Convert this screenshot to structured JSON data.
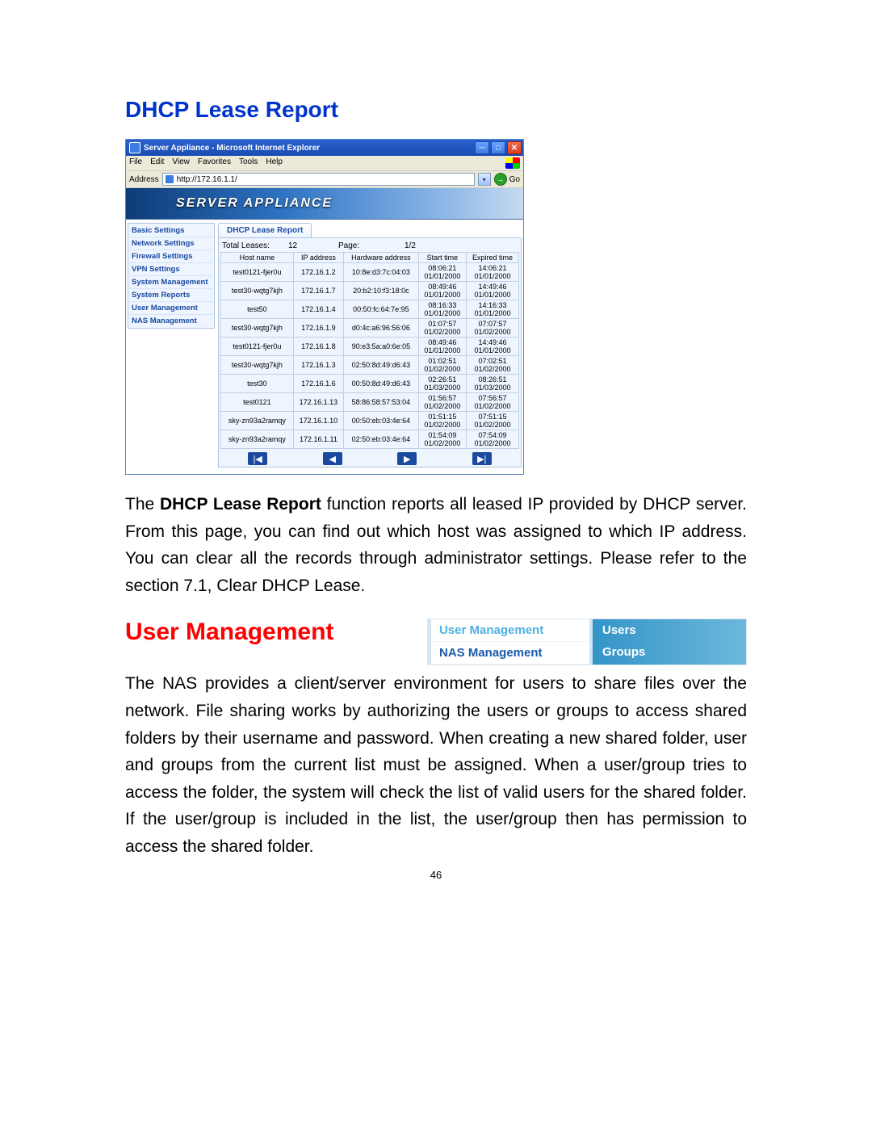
{
  "doc": {
    "heading1": "DHCP Lease Report",
    "para1_prefix": "The ",
    "para1_bold": "DHCP Lease Report",
    "para1_rest": " function reports all leased IP provided by DHCP server. From this page, you can find out which host was assigned to which IP address. You can clear all the records through administrator settings. Please refer to the section 7.1, Clear DHCP Lease.",
    "heading2": "User Management",
    "para2": "The NAS provides a client/server environment for users to share files over the network. File sharing works by authorizing the users or groups to access shared folders by their username and password. When creating a new shared folder, user and groups from the current list must be assigned. When a user/group tries to access the folder, the system will check the list of valid users for the shared folder. If the user/group is included in the list, the user/group then has permission to access the shared folder.",
    "page_number": "46"
  },
  "ie": {
    "title": "Server Appliance - Microsoft Internet Explorer",
    "menus": [
      "File",
      "Edit",
      "View",
      "Favorites",
      "Tools",
      "Help"
    ],
    "address_label": "Address",
    "url": "http://172.16.1.1/",
    "go_label": "Go",
    "banner": "SERVER APPLIANCE",
    "sidebar": [
      "Basic Settings",
      "Network Settings",
      "Firewall Settings",
      "VPN Settings",
      "System Management",
      "System Reports",
      "User Management",
      "NAS Management"
    ],
    "tab": "DHCP Lease Report",
    "summary": {
      "total_label": "Total Leases:",
      "total_value": "12",
      "page_label": "Page:",
      "page_value": "1/2"
    },
    "columns": [
      "Host name",
      "IP address",
      "Hardware address",
      "Start time",
      "Expired time"
    ],
    "rows": [
      {
        "host": "test0121-fjer0u",
        "ip": "172.16.1.2",
        "hw": "10:8e:d3:7c:04:03",
        "st": "08:06:21 01/01/2000",
        "et": "14:06:21 01/01/2000"
      },
      {
        "host": "test30-wqtg7kjh",
        "ip": "172.16.1.7",
        "hw": "20:b2:10:f3:18:0c",
        "st": "08:49:46 01/01/2000",
        "et": "14:49:46 01/01/2000"
      },
      {
        "host": "test50",
        "ip": "172.16.1.4",
        "hw": "00:50:fc:64:7e:95",
        "st": "08:16:33 01/01/2000",
        "et": "14:16:33 01/01/2000"
      },
      {
        "host": "test30-wqtg7kjh",
        "ip": "172.16.1.9",
        "hw": "d0:4c:a6:96:56:06",
        "st": "01:07:57 01/02/2000",
        "et": "07:07:57 01/02/2000"
      },
      {
        "host": "test0121-fjer0u",
        "ip": "172.16.1.8",
        "hw": "90:e3:5a:a0:6e:05",
        "st": "08:49:46 01/01/2000",
        "et": "14:49:46 01/01/2000"
      },
      {
        "host": "test30-wqtg7kjh",
        "ip": "172.16.1.3",
        "hw": "02:50:8d:49:d6:43",
        "st": "01:02:51 01/02/2000",
        "et": "07:02:51 01/02/2000"
      },
      {
        "host": "test30",
        "ip": "172.16.1.6",
        "hw": "00:50:8d:49:d6:43",
        "st": "02:26:51 01/03/2000",
        "et": "08:26:51 01/03/2000"
      },
      {
        "host": "test0121",
        "ip": "172.16.1.13",
        "hw": "58:86:58:57:53:04",
        "st": "01:56:57 01/02/2000",
        "et": "07:56:57 01/02/2000"
      },
      {
        "host": "sky-zn93a2ramqy",
        "ip": "172.16.1.10",
        "hw": "00:50:eb:03:4e:64",
        "st": "01:51:15 01/02/2000",
        "et": "07:51:15 01/02/2000"
      },
      {
        "host": "sky-zn93a2ramqy",
        "ip": "172.16.1.11",
        "hw": "02:50:eb:03:4e:64",
        "st": "01:54:09 01/02/2000",
        "et": "07:54:09 01/02/2000"
      }
    ]
  },
  "fig2": {
    "left": [
      "User Management",
      "NAS Management"
    ],
    "right": [
      "Users",
      "Groups"
    ]
  }
}
